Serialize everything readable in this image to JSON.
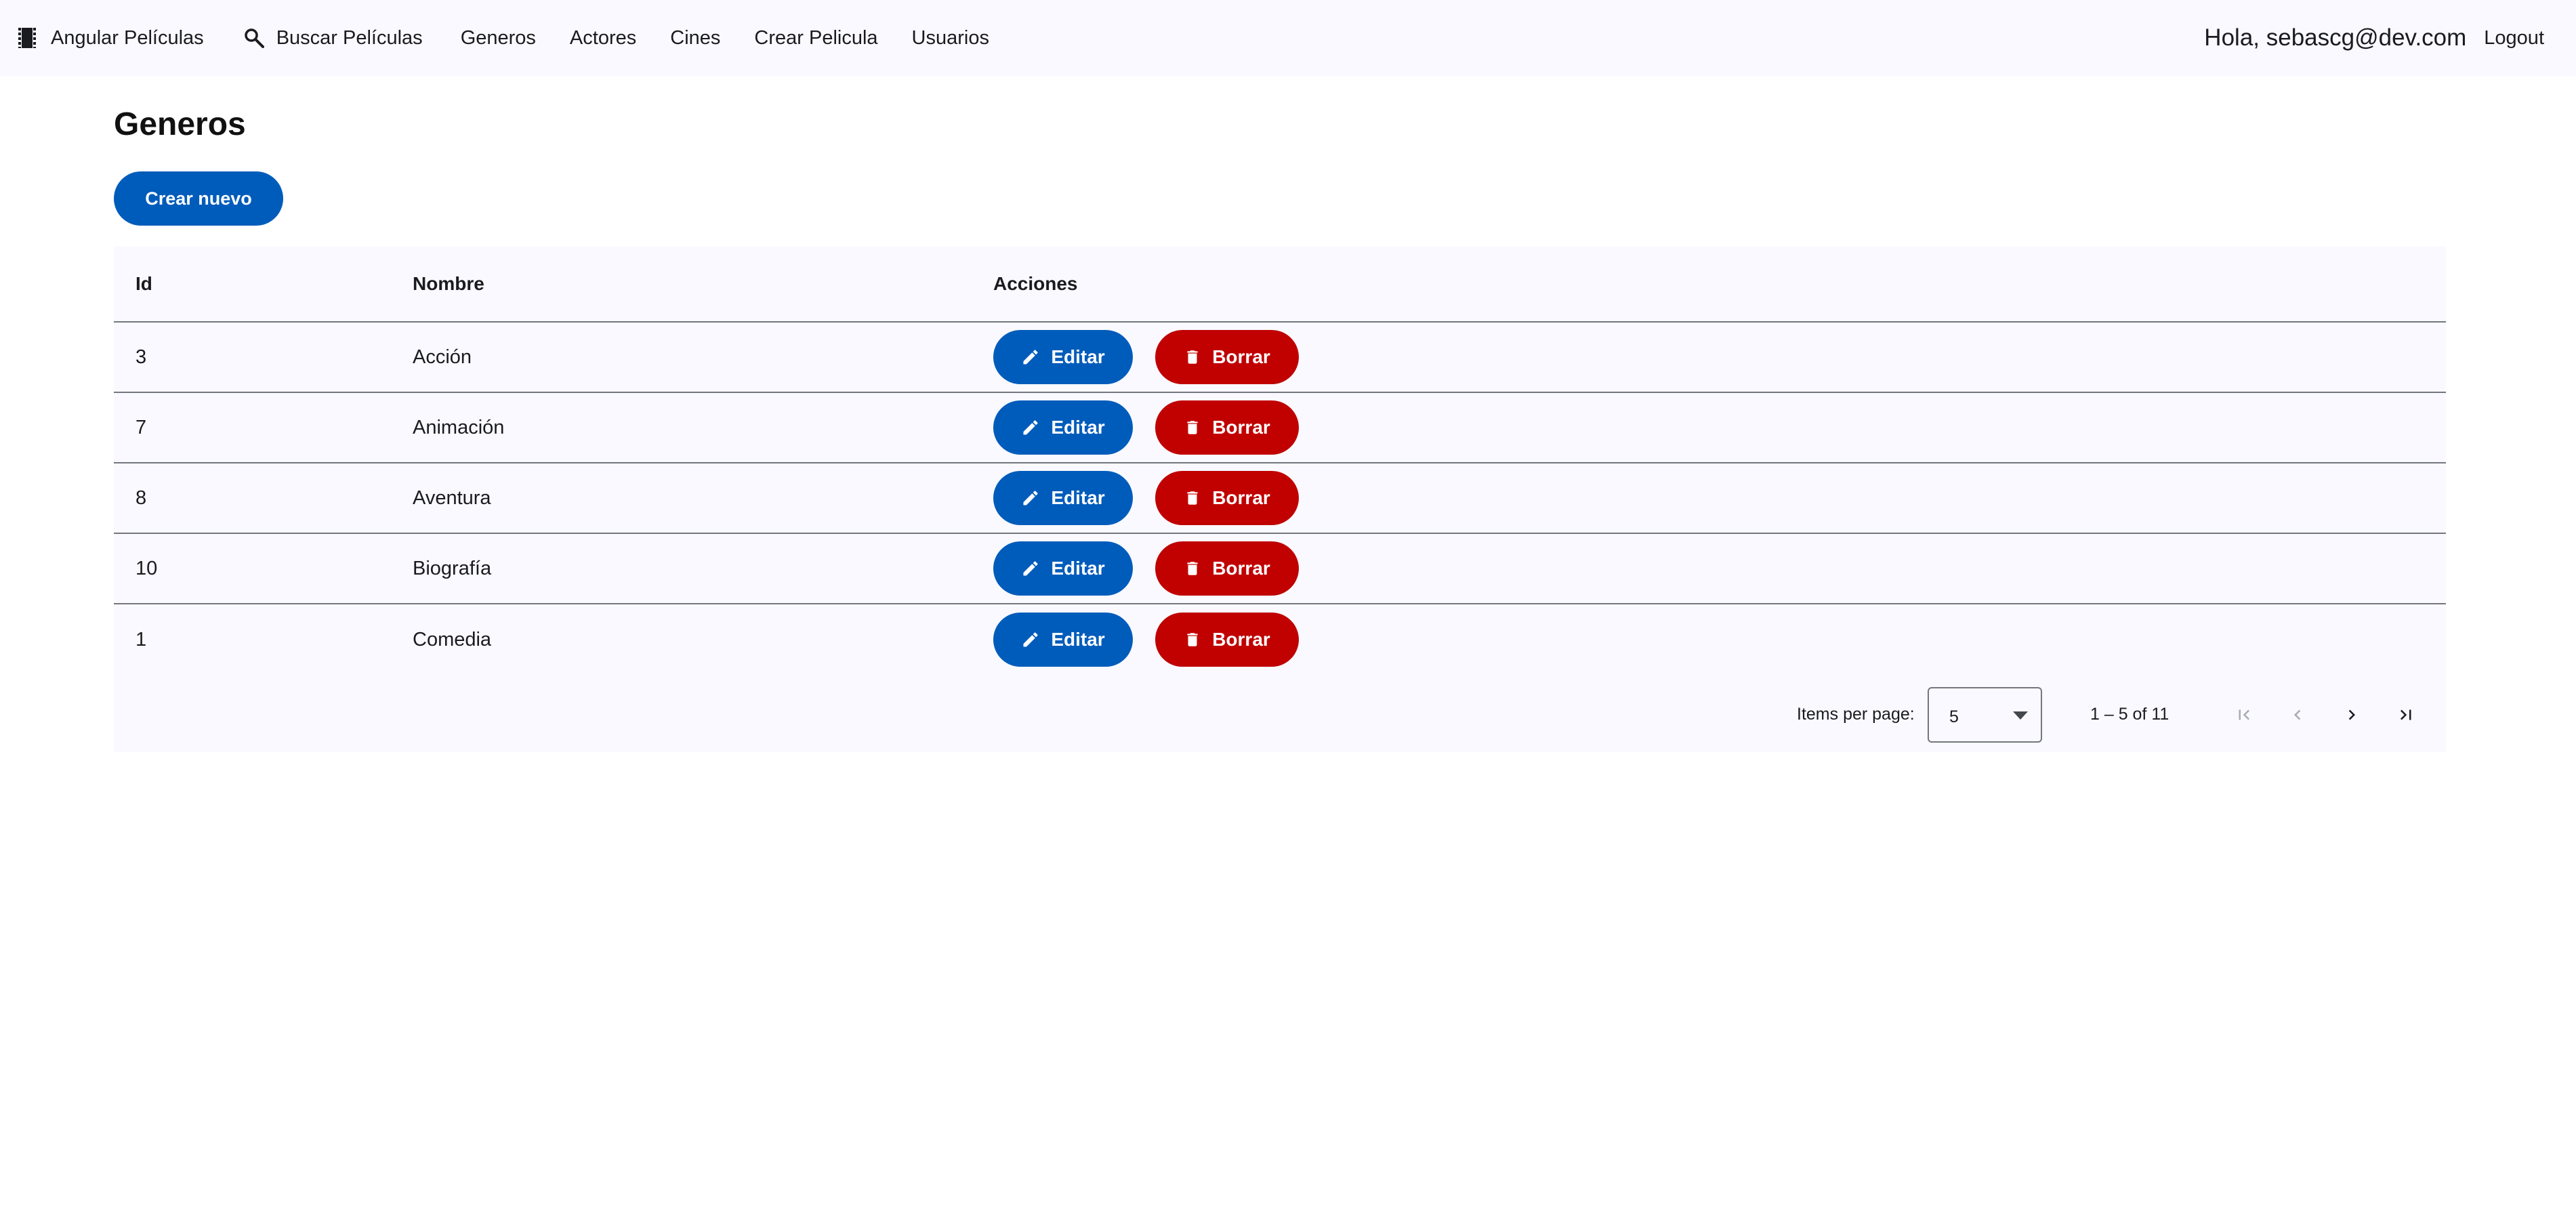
{
  "navbar": {
    "brand": "Angular Películas",
    "brand_icon": "movie-icon",
    "search_label": "Buscar Películas",
    "search_icon": "search-icon",
    "links": [
      "Generos",
      "Actores",
      "Cines",
      "Crear Pelicula",
      "Usuarios"
    ],
    "greeting": "Hola, sebascg@dev.com",
    "logout": "Logout"
  },
  "page": {
    "title": "Generos",
    "create_button": "Crear nuevo"
  },
  "table": {
    "columns": [
      "Id",
      "Nombre",
      "Acciones"
    ],
    "rows": [
      {
        "id": "3",
        "nombre": "Acción"
      },
      {
        "id": "7",
        "nombre": "Animación"
      },
      {
        "id": "8",
        "nombre": "Aventura"
      },
      {
        "id": "10",
        "nombre": "Biografía"
      },
      {
        "id": "1",
        "nombre": "Comedia"
      }
    ],
    "edit_label": "Editar",
    "edit_icon": "pencil-icon",
    "delete_label": "Borrar",
    "delete_icon": "trash-icon"
  },
  "paginator": {
    "items_per_page_label": "Items per page:",
    "page_size": "5",
    "range_label": "1 – 5 of 11",
    "first_page_enabled": false,
    "previous_page_enabled": false,
    "next_page_enabled": true,
    "last_page_enabled": true
  },
  "colors": {
    "primary": "#005cbb",
    "danger": "#c00100",
    "surface": "#f9f9ff",
    "divider": "#74777f"
  }
}
